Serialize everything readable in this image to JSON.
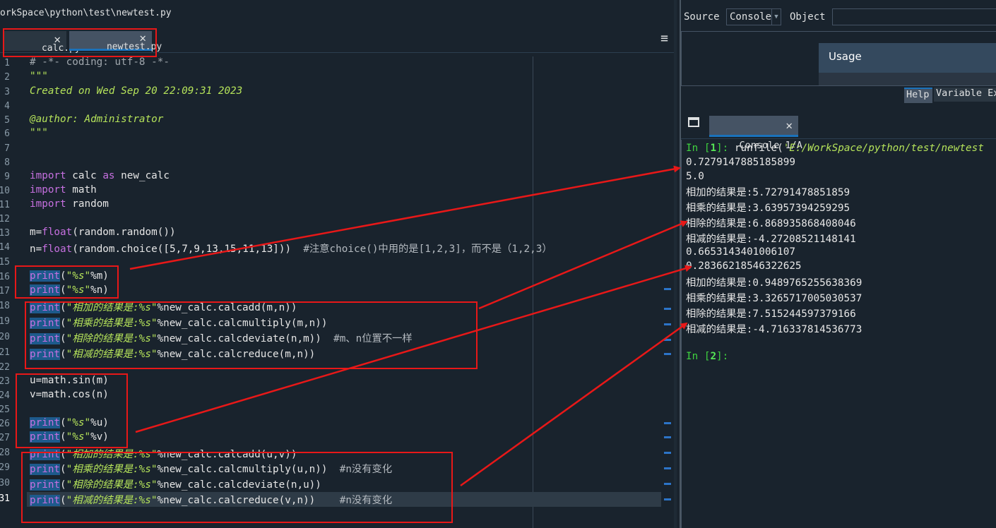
{
  "editor": {
    "path": "orkSpace\\python\\test\\newtest.py",
    "tabs": [
      {
        "label": "calc.py",
        "close": "✕"
      },
      {
        "label": "newtest.py",
        "close": "✕"
      }
    ],
    "menu_icon": "≡",
    "line_numbers": [
      "1",
      "2",
      "3",
      "4",
      "5",
      "6",
      "7",
      "8",
      "9",
      "10",
      "11",
      "12",
      "13",
      "14",
      "15",
      "16",
      "17",
      "18",
      "19",
      "20",
      "21",
      "22",
      "23",
      "24",
      "25",
      "26",
      "27",
      "28",
      "29",
      "30",
      "31"
    ],
    "code": {
      "l1": "# -*- coding: utf-8 -*-",
      "l2": "\"\"\"",
      "l3": "Created on Wed Sep 20 22:09:31 2023",
      "l5": "@author: Administrator",
      "l6": "\"\"\"",
      "l9_kw": "import",
      "l9_a": " calc ",
      "l9_as": "as",
      "l9_b": " new_calc",
      "l10_kw": "import",
      "l10_a": " math",
      "l11_kw": "import",
      "l11_a": " random",
      "l13_a": "m=",
      "l13_fn": "float",
      "l13_b": "(random.random())",
      "l14_a": "n=",
      "l14_fn": "float",
      "l14_b": "(random.choice([5,7,9,13,15,11,13]))  ",
      "l14_c": "#注意choice()中用的是[1,2,3]，而不是（1,2,3）",
      "print": "print",
      "l16_s": "\"%s\"",
      "l16_b": "%m)",
      "l17_s": "\"%s\"",
      "l17_b": "%n)",
      "l18_s": "\"相加的结果是:%s\"",
      "l18_b": "%new_calc.calcadd(m,n))",
      "l19_s": "\"相乘的结果是:%s\"",
      "l19_b": "%new_calc.calcmultiply(m,n))",
      "l20_s": "\"相除的结果是:%s\"",
      "l20_b": "%new_calc.calcdeviate(n,m))  ",
      "l20_c": "#m、n位置不一样",
      "l21_s": "\"相减的结果是:%s\"",
      "l21_b": "%new_calc.calcreduce(m,n))",
      "l23": "u=math.sin(m)",
      "l24": "v=math.cos(n)",
      "l26_s": "\"%s\"",
      "l26_b": "%u)",
      "l27_s": "\"%s\"",
      "l27_b": "%v)",
      "l28_s": "\"相加的结果是:%s\"",
      "l28_b": "%new_calc.calcadd(u,v))",
      "l29_s": "\"相乘的结果是:%s\"",
      "l29_b": "%new_calc.calcmultiply(u,n))  ",
      "l29_c": "#n没有变化",
      "l30_s": "\"相除的结果是:%s\"",
      "l30_b": "%new_calc.calcdeviate(n,u))",
      "l31_s": "\"相减的结果是:%s\"",
      "l31_b": "%new_calc.calcreduce(v,n))    ",
      "l31_c": "#n没有变化"
    }
  },
  "help": {
    "source_label": "Source",
    "source_value": "Console",
    "object_label": "Object",
    "usage_title": "Usage",
    "tabs": [
      "Help",
      "Variable Ex"
    ]
  },
  "console": {
    "tab_label": "Console 1/A",
    "close": "✕",
    "in1_prefix": "In [",
    "in1_num": "1",
    "in1_suffix": "]: ",
    "in1_call": "runfile(",
    "in1_arg": "'E:/WorkSpace/python/test/newtest",
    "outputs": [
      "0.7279147885185899",
      "5.0",
      "相加的结果是:5.72791478851859",
      "相乘的结果是:3.63957394259295",
      "相除的结果是:6.868935868408046",
      "相减的结果是:-4.27208521148141",
      "0.6653143401006107",
      "0.28366218546322625",
      "相加的结果是:0.9489765255638369",
      "相乘的结果是:3.3265717005030537",
      "相除的结果是:7.515244597379166",
      "相减的结果是:-4.716337814536773"
    ],
    "in2_prefix": "In [",
    "in2_num": "2",
    "in2_suffix": "]:",
    "accent": "#3fd23f"
  },
  "annotation_color": "#e81818"
}
